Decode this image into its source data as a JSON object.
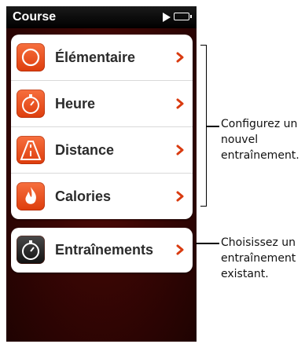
{
  "status_bar": {
    "title": "Course",
    "play_icon": "play-icon",
    "battery_icon": "battery-full-icon"
  },
  "menu": {
    "items": [
      {
        "label": "Élémentaire",
        "icon": "basic-circle-icon"
      },
      {
        "label": "Heure",
        "icon": "stopwatch-icon"
      },
      {
        "label": "Distance",
        "icon": "road-icon"
      },
      {
        "label": "Calories",
        "icon": "flame-icon"
      }
    ],
    "workouts": {
      "label": "Entraînements",
      "icon": "stopwatch-icon"
    }
  },
  "callouts": {
    "new_workout": "Configurez un nouvel entraînement.",
    "existing_workout": "Choisissez un entraînement existant."
  },
  "colors": {
    "accent": "#e8552a",
    "chevron": "#d93b10",
    "background": "#3a0604"
  }
}
